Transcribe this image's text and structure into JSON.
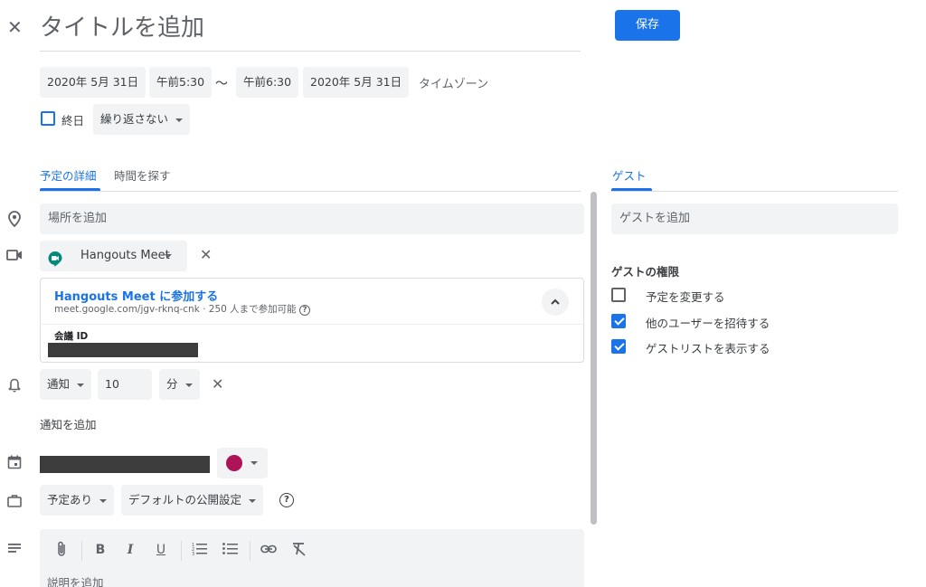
{
  "header": {
    "close_glyph": "✕",
    "title_placeholder": "タイトルを追加",
    "save_label": "保存"
  },
  "datetime": {
    "start_date": "2020年 5月 31日",
    "start_time": "午前5:30",
    "separator": "〜",
    "end_time": "午前6:30",
    "end_date": "2020年 5月 31日",
    "timezone_label": "タイムゾーン",
    "all_day_label": "終日",
    "repeat_label": "繰り返さない"
  },
  "tabs": {
    "details": "予定の詳細",
    "find_time": "時間を探す",
    "guests": "ゲスト"
  },
  "details": {
    "location_placeholder": "場所を追加",
    "conference_label": "Hangouts Meet",
    "join_link_label": "Hangouts Meet に参加する",
    "meet_info": "meet.google.com/jgv-rknq-cnk · 250 人まで参加可能",
    "meeting_id_label": "会議 ID",
    "notification_type": "通知",
    "notification_value": "10",
    "notification_unit": "分",
    "add_notification_label": "通知を追加",
    "availability_label": "予定あり",
    "visibility_label": "デフォルトの公開設定",
    "description_placeholder": "説明を追加",
    "calendar_color": "#ad1457"
  },
  "toolbar": {
    "bold": "B",
    "italic": "I",
    "underline": "U"
  },
  "guests": {
    "add_placeholder": "ゲストを追加",
    "permissions_title": "ゲストの権限",
    "permissions": [
      {
        "label": "予定を変更する",
        "checked": false
      },
      {
        "label": "他のユーザーを招待する",
        "checked": true
      },
      {
        "label": "ゲストリストを表示する",
        "checked": true
      }
    ]
  },
  "colors": {
    "accent": "#1a73e8",
    "meet_green": "#00897b",
    "chip_bg": "#f1f3f4",
    "redacted": "#3c3c3c"
  }
}
